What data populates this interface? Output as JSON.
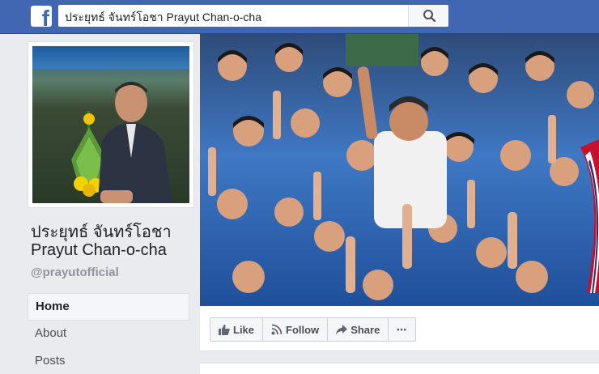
{
  "topbar": {
    "logo_letter": "f",
    "search_value": "ประยุทธ์ จันทร์โอชา Prayut Chan-o-cha",
    "search_icon": "search-icon",
    "colors": {
      "bar": "#4267b2"
    }
  },
  "profile": {
    "name_thai": "ประยุทธ์ จันทร์โอชา",
    "name_english": "Prayut Chan-o-cha",
    "handle": "@prayutofficial"
  },
  "nav": {
    "items": [
      {
        "label": "Home",
        "active": true
      },
      {
        "label": "About",
        "active": false
      },
      {
        "label": "Posts",
        "active": false
      }
    ]
  },
  "actions": {
    "like_label": "Like",
    "follow_label": "Follow",
    "share_label": "Share",
    "more_label": "•••",
    "icons": [
      "thumbs-up-icon",
      "rss-icon",
      "share-arrow-icon",
      "more-icon"
    ]
  }
}
